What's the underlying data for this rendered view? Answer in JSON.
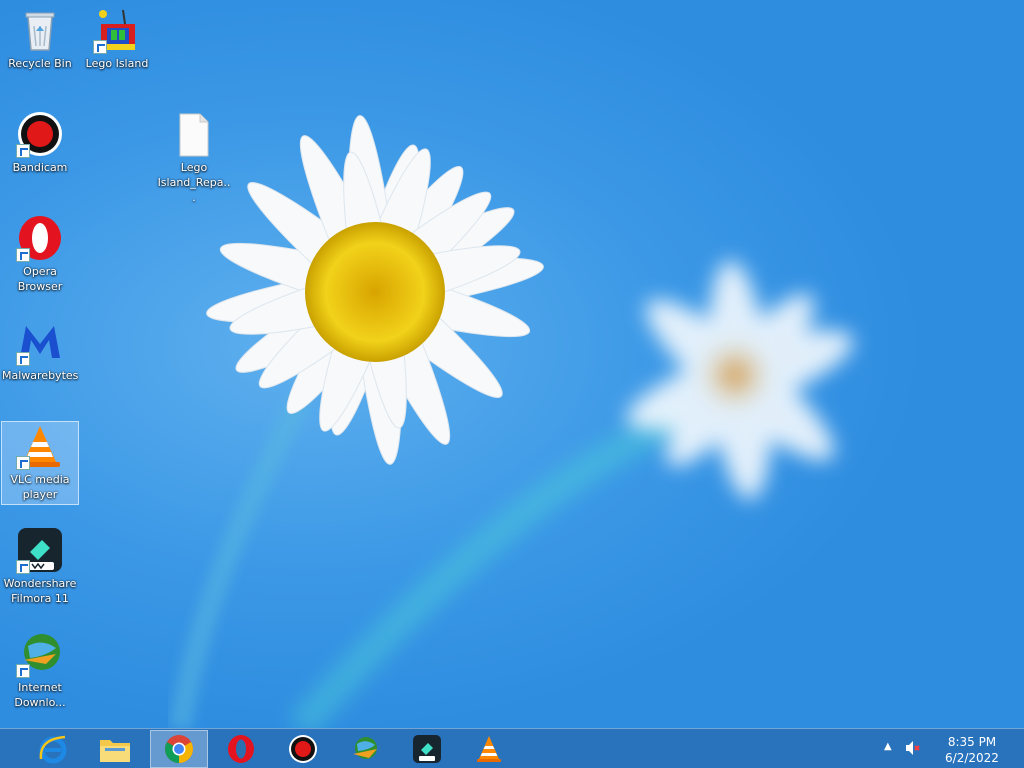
{
  "desktop": {
    "icons": [
      {
        "label": "Recycle Bin",
        "icon": "recycle-bin-icon"
      },
      {
        "label": "Lego Island",
        "icon": "lego-island-icon"
      },
      {
        "label": "Bandicam",
        "icon": "bandicam-icon"
      },
      {
        "label": "Lego Island_Repa...",
        "icon": "file-icon"
      },
      {
        "label": "Opera Browser",
        "icon": "opera-icon"
      },
      {
        "label": "Malwarebytes",
        "icon": "malwarebytes-icon"
      },
      {
        "label": "VLC media player",
        "icon": "vlc-icon",
        "selected": true
      },
      {
        "label": "Wondershare Filmora 11",
        "icon": "filmora-icon"
      },
      {
        "label": "Internet Downlo...",
        "icon": "idm-icon"
      }
    ]
  },
  "taskbar": {
    "buttons": [
      {
        "name": "Internet Explorer",
        "icon": "internet-explorer-icon"
      },
      {
        "name": "File Explorer",
        "icon": "folder-icon"
      },
      {
        "name": "Google Chrome",
        "icon": "chrome-icon",
        "active": true
      },
      {
        "name": "Opera",
        "icon": "opera-icon"
      },
      {
        "name": "Bandicam",
        "icon": "bandicam-icon"
      },
      {
        "name": "Internet Download Manager",
        "icon": "idm-icon"
      },
      {
        "name": "Filmora",
        "icon": "filmora-icon"
      },
      {
        "name": "VLC",
        "icon": "vlc-icon"
      }
    ],
    "tray": {
      "time": "8:35 PM",
      "date": "6/2/2022",
      "volume_state": "muted"
    }
  },
  "colors": {
    "wallpaper_blue": "#3b98e6",
    "taskbar": "#286eb4",
    "flower_center": "#e6b800"
  }
}
